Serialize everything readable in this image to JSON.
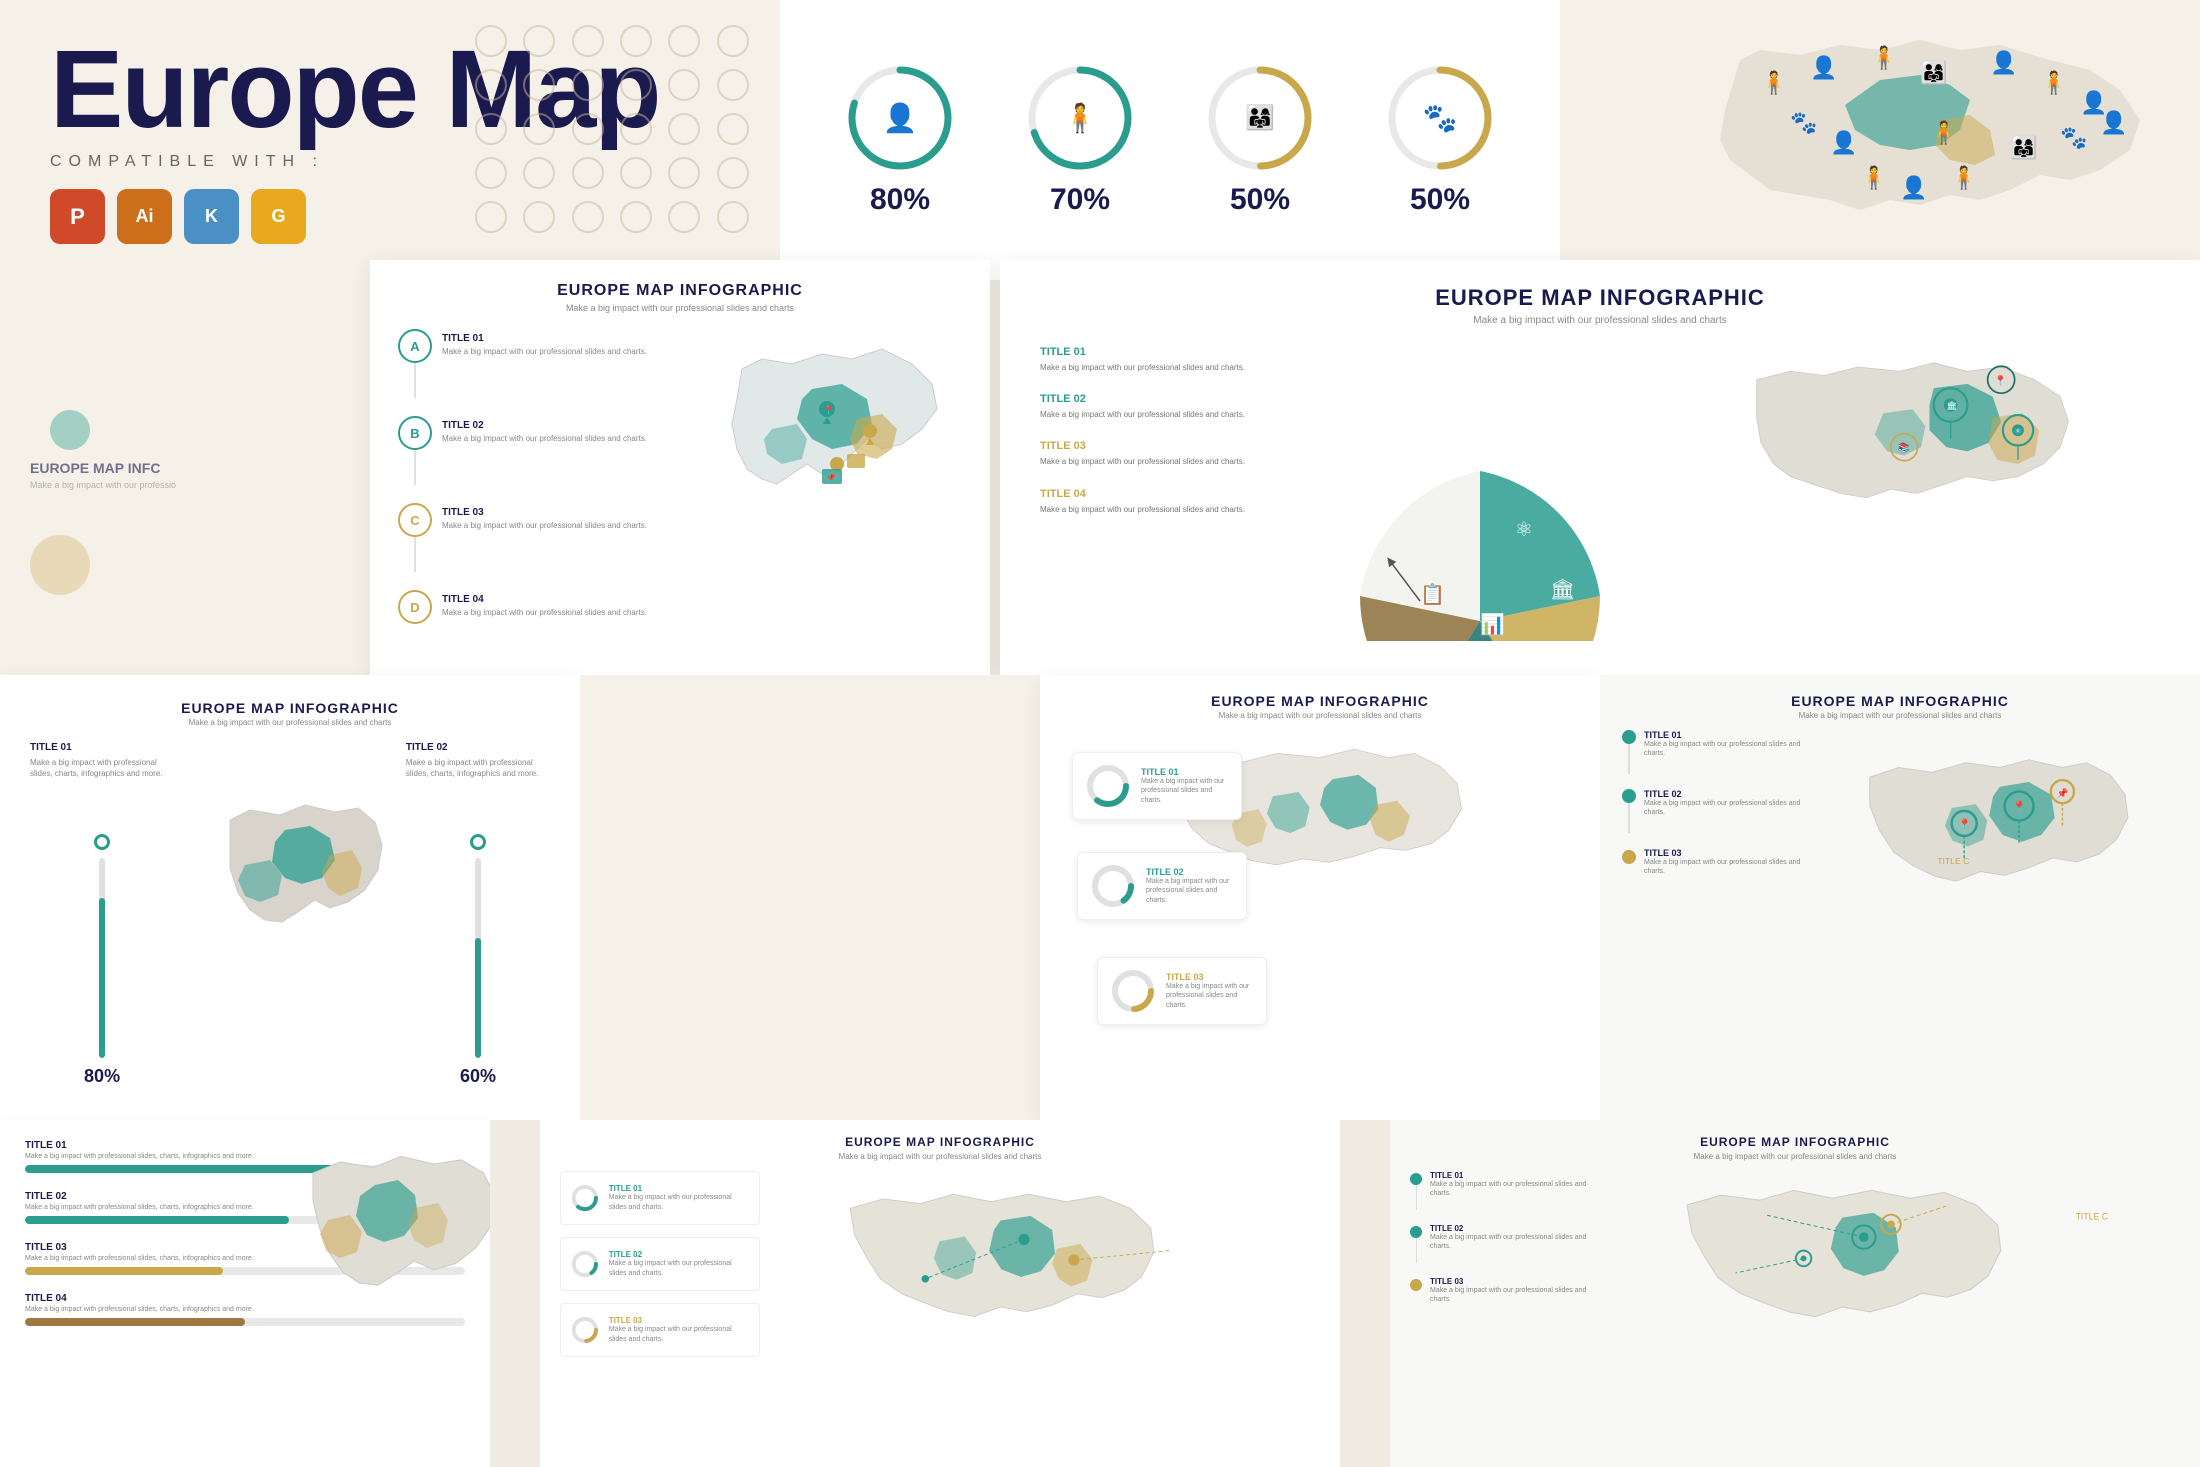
{
  "hero": {
    "title": "Europe Map",
    "subtitle": "COMPATIBLE WITH :",
    "apps": [
      "PowerPoint",
      "Illustrator",
      "Keynote",
      "Google Slides"
    ],
    "app_letters": [
      "P",
      "Ai",
      "K",
      "G"
    ]
  },
  "stats": {
    "items": [
      {
        "value": "80%",
        "color_ring": "#2a9d8f",
        "icon": "👤",
        "ring_pct": 80
      },
      {
        "value": "70%",
        "color_ring": "#2a9d8f",
        "icon": "👤",
        "ring_pct": 70
      },
      {
        "value": "50%",
        "color_ring": "#c9a84c",
        "icon": "👨‍👩‍👧",
        "ring_pct": 50
      },
      {
        "value": "50%",
        "color_ring": "#c9a84c",
        "icon": "🐾",
        "ring_pct": 50
      }
    ]
  },
  "slide1": {
    "title": "EUROPE MAP INFOGRAPHIC",
    "subtitle": "Make a big impact with our professional slides and charts",
    "items": [
      {
        "label": "A",
        "title": "TITLE 01",
        "desc": "Make a big impact with our professional slides and charts."
      },
      {
        "label": "B",
        "title": "TITLE 02",
        "desc": "Make a big impact with our professional slides and charts."
      },
      {
        "label": "C",
        "title": "TITLE 03",
        "desc": "Make a big impact with our professional slides and charts."
      },
      {
        "label": "D",
        "title": "TITLE 04",
        "desc": "Make a big impact with our professional slides and charts."
      }
    ]
  },
  "slide2": {
    "title": "EUROPE MAP INFOGRAPHIC",
    "subtitle": "Make a big impact with our professional slides and charts",
    "items": [
      {
        "title": "TITLE 01",
        "desc": "Make a big impact with our professional slides and charts."
      },
      {
        "title": "TITLE 02",
        "desc": "Make a big impact with our professional slides and charts."
      },
      {
        "title": "TITLE 03",
        "desc": "Make a big impact with our professional slides and charts."
      },
      {
        "title": "TITLE 04",
        "desc": "Make a big impact with our professional slides and charts."
      }
    ]
  },
  "slide_progress": {
    "title": "EUROPE MAP INFOGRAPHIC",
    "subtitle": "Make a big impact with our professional slides and charts",
    "title01": "TITLE 01",
    "title02": "TITLE 02",
    "desc01": "Make a big impact with professional slides, charts, infographics and more.",
    "desc02": "Make a big impact with professional slides, charts, infographics and more.",
    "pct01": 80,
    "pct02": 60,
    "label01": "80%",
    "label02": "60%"
  },
  "slide_bars": {
    "items": [
      {
        "title": "TITLE 01",
        "desc": "Make a big impact with professional slides, charts, infographics and more.",
        "pct": 75,
        "color": "#2a9d8f"
      },
      {
        "title": "TITLE 02",
        "desc": "Make a big impact with professional slides, charts, infographics and more.",
        "pct": 60,
        "color": "#2a9d8f"
      },
      {
        "title": "TITLE 03",
        "desc": "Make a big impact with professional slides, charts, infographics and more.",
        "pct": 45,
        "color": "#c9a84c"
      },
      {
        "title": "TITLE 04",
        "desc": "Make a big impact with professional slides, charts, infographics and more.",
        "pct": 50,
        "color": "#a07840"
      }
    ]
  },
  "slide_bottom_center": {
    "title": "EUROPE MAP INFOGRAPHIC",
    "subtitle": "Make a big impact with our professional slides and charts",
    "items": [
      {
        "title": "TITLE 01",
        "desc": "Make a big impact with our professional slides and charts."
      },
      {
        "title": "TITLE 02",
        "desc": "Make a big impact with our professional slides and charts."
      },
      {
        "title": "TITLE 03",
        "desc": "Make a big impact with our professional slides and charts."
      }
    ]
  },
  "slide_bottom_right": {
    "title": "EUROPE MAP INFOGRAPHIC",
    "subtitle": "Make a big impact with our professional slides and charts",
    "items": [
      {
        "title": "TITLE 01",
        "desc": "Make a big impact with our professional slides and charts."
      },
      {
        "title": "TITLE 02",
        "desc": "Make a big impact with our professional slides and charts."
      },
      {
        "title": "TITLE 03",
        "desc": "Make a big impact with our professional slides and charts."
      }
    ]
  },
  "colors": {
    "teal": "#2a9d8f",
    "teal_dark": "#1a6e6a",
    "gold": "#c9a84c",
    "navy": "#1a1a4e",
    "bg_cream": "#f5f0e8",
    "bg_light": "#f8f6f1"
  }
}
